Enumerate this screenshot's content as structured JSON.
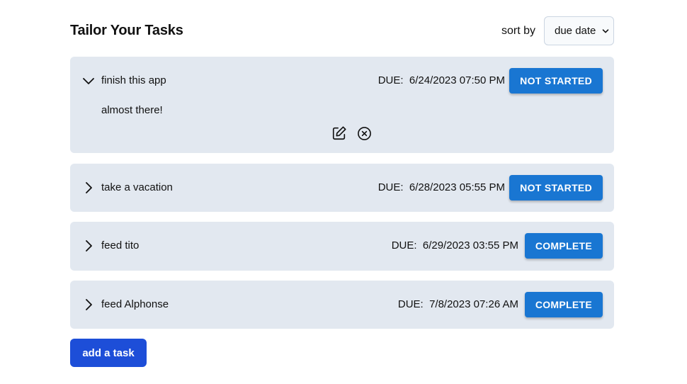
{
  "header": {
    "title": "Tailor Your Tasks",
    "sort_label": "sort by",
    "sort_value": "due date"
  },
  "tasks": [
    {
      "title": "finish this app",
      "due_label": "DUE:",
      "due": "6/24/2023 07:50 PM",
      "status": "NOT STARTED",
      "expanded": true,
      "description": "almost there!"
    },
    {
      "title": "take a vacation",
      "due_label": "DUE:",
      "due": "6/28/2023 05:55 PM",
      "status": "NOT STARTED",
      "expanded": false
    },
    {
      "title": "feed tito",
      "due_label": "DUE:",
      "due": "6/29/2023 03:55 PM",
      "status": "COMPLETE",
      "expanded": false
    },
    {
      "title": "feed Alphonse",
      "due_label": "DUE:",
      "due": "7/8/2023 07:26 AM",
      "status": "COMPLETE",
      "expanded": false
    }
  ],
  "add_button_label": "add a task",
  "icons": {
    "expanded": "chevron-down-icon",
    "collapsed": "chevron-right-icon",
    "edit": "edit-icon",
    "delete": "close-circle-icon"
  },
  "colors": {
    "card_bg": "#e2e8f0",
    "status_button": "#1976d2",
    "add_button": "#1d4ed8"
  }
}
